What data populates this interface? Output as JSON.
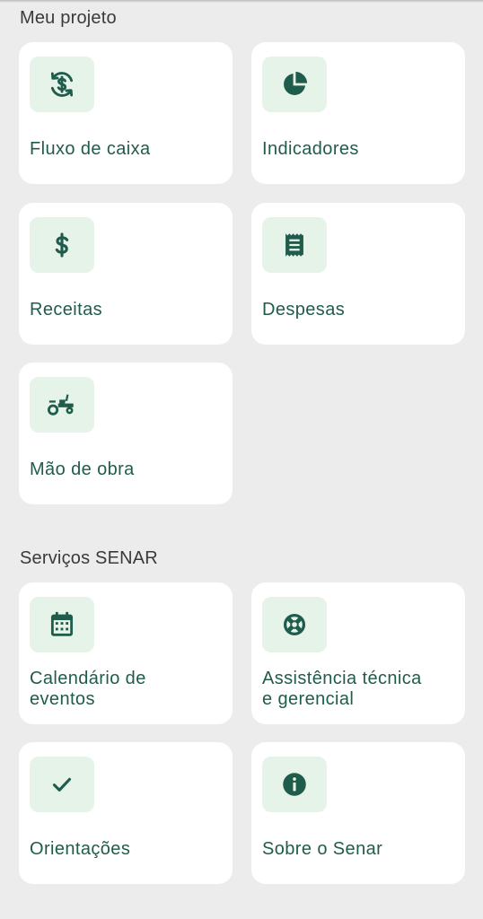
{
  "sections": [
    {
      "title": "Meu projeto",
      "cards": [
        {
          "label": "Fluxo de caixa",
          "icon": "cash-flow-icon"
        },
        {
          "label": "Indicadores",
          "icon": "pie-chart-icon"
        },
        {
          "label": "Receitas",
          "icon": "dollar-icon"
        },
        {
          "label": "Despesas",
          "icon": "receipt-icon"
        },
        {
          "label": "Mão de obra",
          "icon": "tractor-icon"
        }
      ]
    },
    {
      "title": "Serviços SENAR",
      "cards": [
        {
          "label_line1": "Calendário de",
          "label_line2": "eventos",
          "icon": "calendar-icon"
        },
        {
          "label_line1": "Assistência técnica",
          "label_line2": "e gerencial",
          "icon": "lifebuoy-icon"
        },
        {
          "label": "Orientações",
          "icon": "check-icon"
        },
        {
          "label": "Sobre o Senar",
          "icon": "info-icon"
        }
      ]
    }
  ],
  "colors": {
    "background": "#ececec",
    "card": "#ffffff",
    "icon_bg": "#e6f3e8",
    "accent": "#1f5c4c",
    "section_title": "#3a3a3a"
  }
}
